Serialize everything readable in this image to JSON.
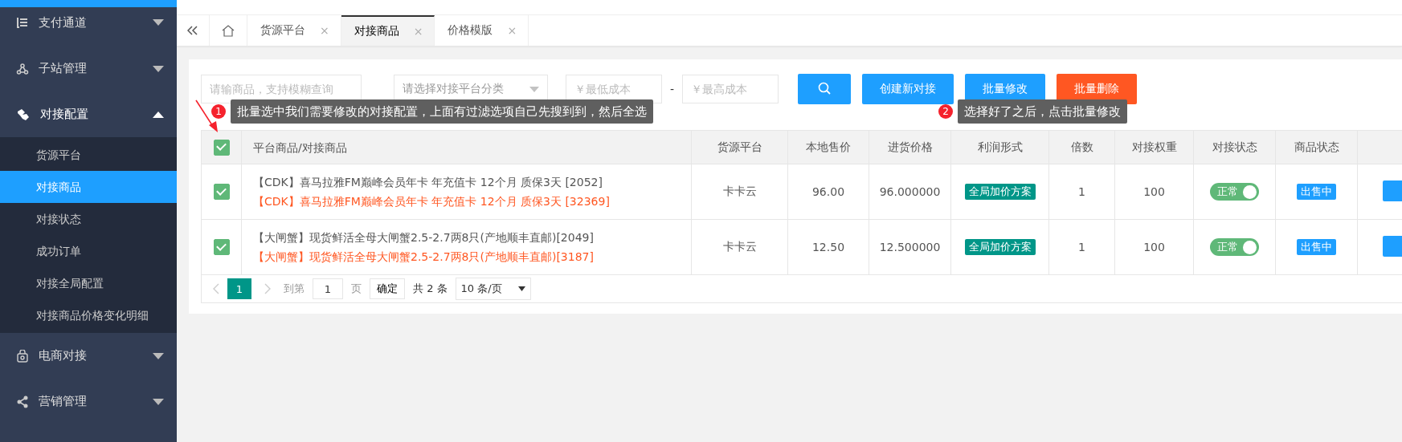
{
  "sidebar": {
    "items": [
      {
        "label": "支付通道",
        "expanded": false
      },
      {
        "label": "子站管理",
        "expanded": false
      },
      {
        "label": "对接配置",
        "expanded": true,
        "children": [
          {
            "label": "货源平台",
            "selected": false
          },
          {
            "label": "对接商品",
            "selected": true
          },
          {
            "label": "对接状态",
            "selected": false
          },
          {
            "label": "成功订单",
            "selected": false
          },
          {
            "label": "对接全局配置",
            "selected": false
          },
          {
            "label": "对接商品价格变化明细",
            "selected": false
          }
        ]
      },
      {
        "label": "电商对接",
        "expanded": false
      },
      {
        "label": "营销管理",
        "expanded": false
      }
    ]
  },
  "tabs": [
    {
      "label": "货源平台",
      "selected": false,
      "close": "×"
    },
    {
      "label": "对接商品",
      "selected": true,
      "close": "×"
    },
    {
      "label": "价格模版",
      "selected": false,
      "close": "×"
    }
  ],
  "filters": {
    "search": {
      "placeholder": "请输商品，支持模糊查询"
    },
    "category": {
      "placeholder": "请选择对接平台分类"
    },
    "min_cost": {
      "placeholder": "￥最低成本"
    },
    "range_separator": "-",
    "max_cost": {
      "placeholder": "￥最高成本"
    },
    "buttons": [
      {
        "kind": "search"
      },
      {
        "kind": "primary",
        "label": "创建新对接"
      },
      {
        "kind": "primary",
        "label": "批量修改"
      },
      {
        "kind": "danger",
        "label": "批量删除"
      }
    ]
  },
  "annotations": [
    {
      "number": "1",
      "text": "批量选中我们需要修改的对接配置，上面有过滤选项自己先搜到到，然后全选"
    },
    {
      "number": "2",
      "text": "选择好了之后，点击批量修改"
    }
  ],
  "table": {
    "select_all": {
      "checked": true
    },
    "columns": [
      "平台商品/对接商品",
      "货源平台",
      "本地售价",
      "进货价格",
      "利润形式",
      "倍数",
      "对接权重",
      "对接状态",
      "商品状态"
    ],
    "rows": [
      {
        "checked": true,
        "product": "【CDK】喜马拉雅FM巅峰会员年卡 年充值卡 12个月 质保3天 [2052]",
        "remote_product": "【CDK】喜马拉雅FM巅峰会员年卡 年充值卡 12个月 质保3天 [32369]",
        "platform": "卡卡云",
        "local_price": "96.00",
        "cost_price": "96.000000",
        "profit_mode": "全局加价方案",
        "multiplier": "1",
        "weight": "100",
        "dock_status": {
          "label": "正常",
          "on": true
        },
        "goods_status": "出售中"
      },
      {
        "checked": true,
        "product": "【大闸蟹】现货鲜活全母大闸蟹2.5-2.7两8只(产地顺丰直邮)[2049]",
        "remote_product": "【大闸蟹】现货鲜活全母大闸蟹2.5-2.7两8只(产地顺丰直邮)[3187]",
        "platform": "卡卡云",
        "local_price": "12.50",
        "cost_price": "12.500000",
        "profit_mode": "全局加价方案",
        "multiplier": "1",
        "weight": "100",
        "dock_status": {
          "label": "正常",
          "on": true
        },
        "goods_status": "出售中"
      }
    ]
  },
  "pagination": {
    "pages": [
      {
        "label": "1",
        "selected": true
      }
    ],
    "goto_label": "到第",
    "goto_value": "1",
    "page_unit": "页",
    "confirm": "确定",
    "total": "共 2 条",
    "page_size": "10 条/页"
  }
}
